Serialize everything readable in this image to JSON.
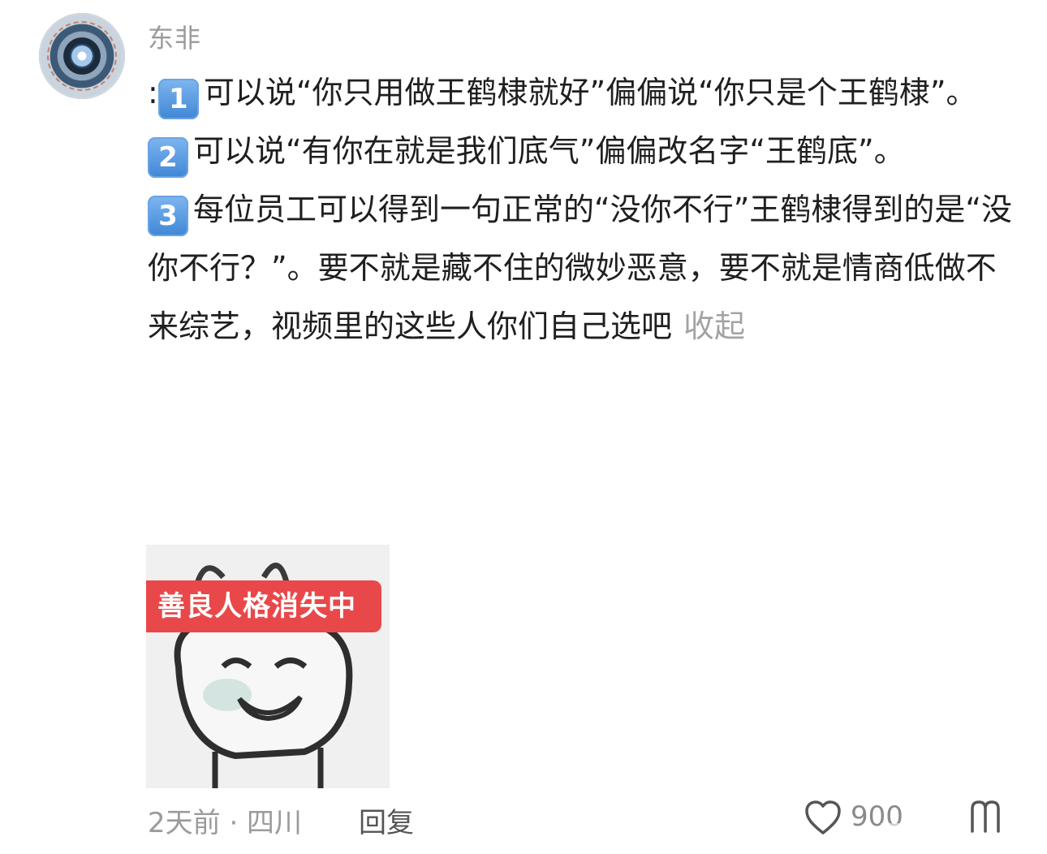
{
  "user": {
    "name": "东非"
  },
  "comment": {
    "prefix": ":",
    "items": [
      {
        "num": "1",
        "text": "可以说“你只用做王鹤棣就好”偏偏说“你只是个王鹤棣”。"
      },
      {
        "num": "2",
        "text": "可以说“有你在就是我们底气”偏偏改名字“王鹤底”。"
      },
      {
        "num": "3",
        "text": "每位员工可以得到一句正常的“没你不行”王鹤棣得到的是“没你不行？”。要不就是藏不住的微妙恶意，要不就是情商低做不来综艺，视频里的这些人你们自己选吧"
      }
    ],
    "collapse_label": "收起"
  },
  "image": {
    "label": "善良人格消失中"
  },
  "footer": {
    "time_location": "2天前 · 四川",
    "reply_label": "回复",
    "like_count": "900"
  },
  "icons": {
    "avatar": "avatar-image",
    "like": "heart-icon",
    "more": "reaction-icon"
  },
  "colors": {
    "muted_text": "#9b9b9b",
    "keycap_blue": "#3f86d6",
    "meme_red": "#e9484a"
  }
}
